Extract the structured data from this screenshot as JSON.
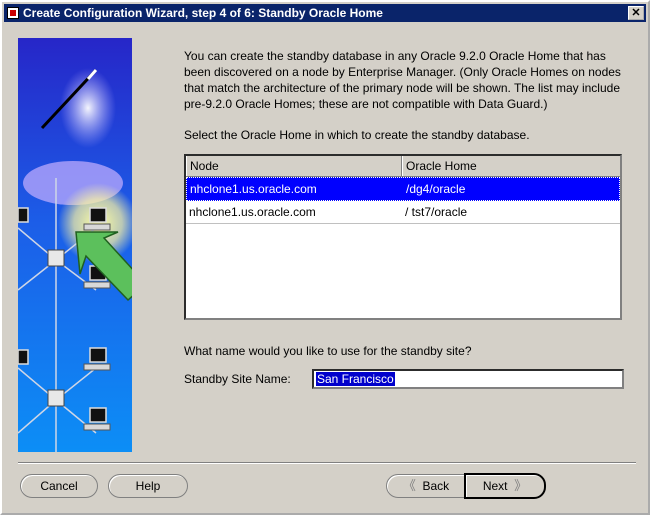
{
  "window": {
    "title": "Create Configuration Wizard, step 4 of 6: Standby Oracle Home",
    "close_glyph": "✕"
  },
  "intro_text": "You can create the standby database in any Oracle 9.2.0 Oracle Home that has been discovered on a node by Enterprise Manager. (Only Oracle Homes on nodes that match the architecture of the primary node will be shown. The list may include pre-9.2.0 Oracle Homes; these are not compatible with Data Guard.)",
  "select_prompt": "Select the Oracle Home in which to create the standby database.",
  "table": {
    "columns": [
      "Node",
      "Oracle Home"
    ],
    "rows": [
      {
        "node": "nhclone1.us.oracle.com",
        "home": "/dg4/oracle",
        "selected": true
      },
      {
        "node": "nhclone1.us.oracle.com",
        "home": "/ tst7/oracle",
        "selected": false
      }
    ]
  },
  "site_question": "What name would you like to use for the standby site?",
  "site_label": "Standby Site Name:",
  "site_value": "San Francisco",
  "buttons": {
    "cancel": "Cancel",
    "help": "Help",
    "back": "Back",
    "next": "Next",
    "back_arrow": "《",
    "next_arrow": "》"
  },
  "colors": {
    "titlebar": "#0a246a",
    "selection": "#0000ff",
    "dialog_bg": "#d4d0c8"
  },
  "icons": [
    "wizard-wand-icon",
    "network-nodes-icon",
    "close-icon"
  ]
}
